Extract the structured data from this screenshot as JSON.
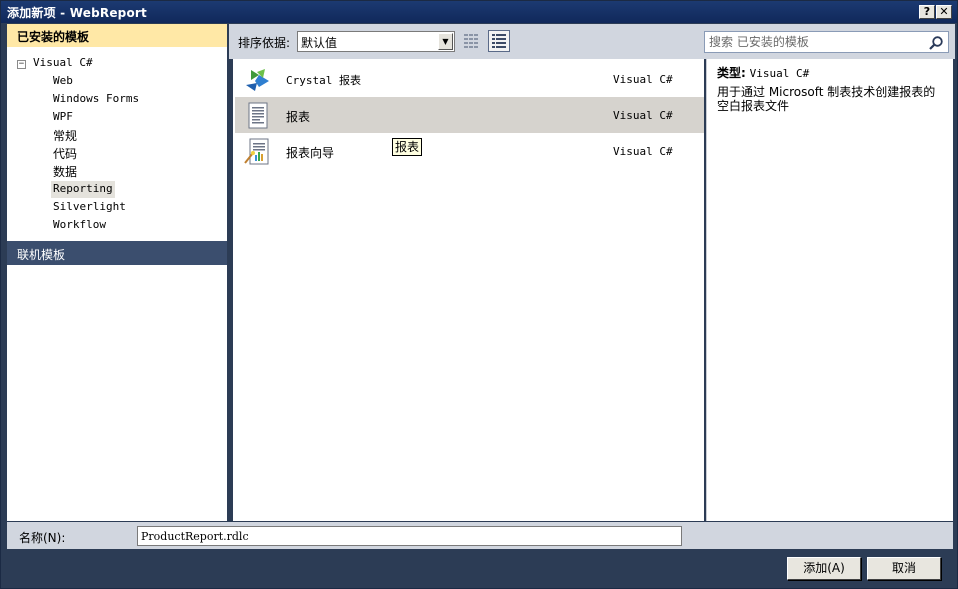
{
  "window": {
    "title": "添加新项 - WebReport",
    "help_button": "?",
    "close_button": "✕"
  },
  "left_pane": {
    "installed_header": "已安装的模板",
    "tree_root": {
      "toggle": "−",
      "label": "Visual C#"
    },
    "tree_items": [
      {
        "label": "Web"
      },
      {
        "label": "Windows Forms"
      },
      {
        "label": "WPF"
      },
      {
        "label": "常规"
      },
      {
        "label": "代码"
      },
      {
        "label": "数据"
      },
      {
        "label": "Reporting",
        "selected": true
      },
      {
        "label": "Silverlight"
      },
      {
        "label": "Workflow"
      }
    ],
    "online_header": "联机模板"
  },
  "toolbar": {
    "sort_label": "排序依据:",
    "sort_value": "默认值",
    "view_modes": [
      "grid-view-icon",
      "list-view-icon"
    ]
  },
  "templates": [
    {
      "name": "Crystal 报表",
      "language": "Visual C#",
      "icon": "crystal-report-icon"
    },
    {
      "name": "报表",
      "language": "Visual C#",
      "icon": "report-icon",
      "selected": true
    },
    {
      "name": "报表向导",
      "language": "Visual C#",
      "icon": "report-wizard-icon"
    }
  ],
  "tooltip": "报表",
  "search": {
    "placeholder": "搜索 已安装的模板"
  },
  "details": {
    "type_label": "类型:",
    "type_value": "Visual C#",
    "description": "用于通过 Microsoft 制表技术创建报表的空白报表文件"
  },
  "bottom": {
    "name_label": "名称(N):",
    "name_value": "ProductReport.rdlc",
    "add_button": "添加(A)",
    "cancel_button": "取消"
  },
  "colors": {
    "title_bar": "#10285a",
    "installed_header_bg": "#ffe8a6",
    "selected_row_bg": "#d6d3ce",
    "header_strip": "#d1d6df",
    "frame": "#2c3c55"
  }
}
